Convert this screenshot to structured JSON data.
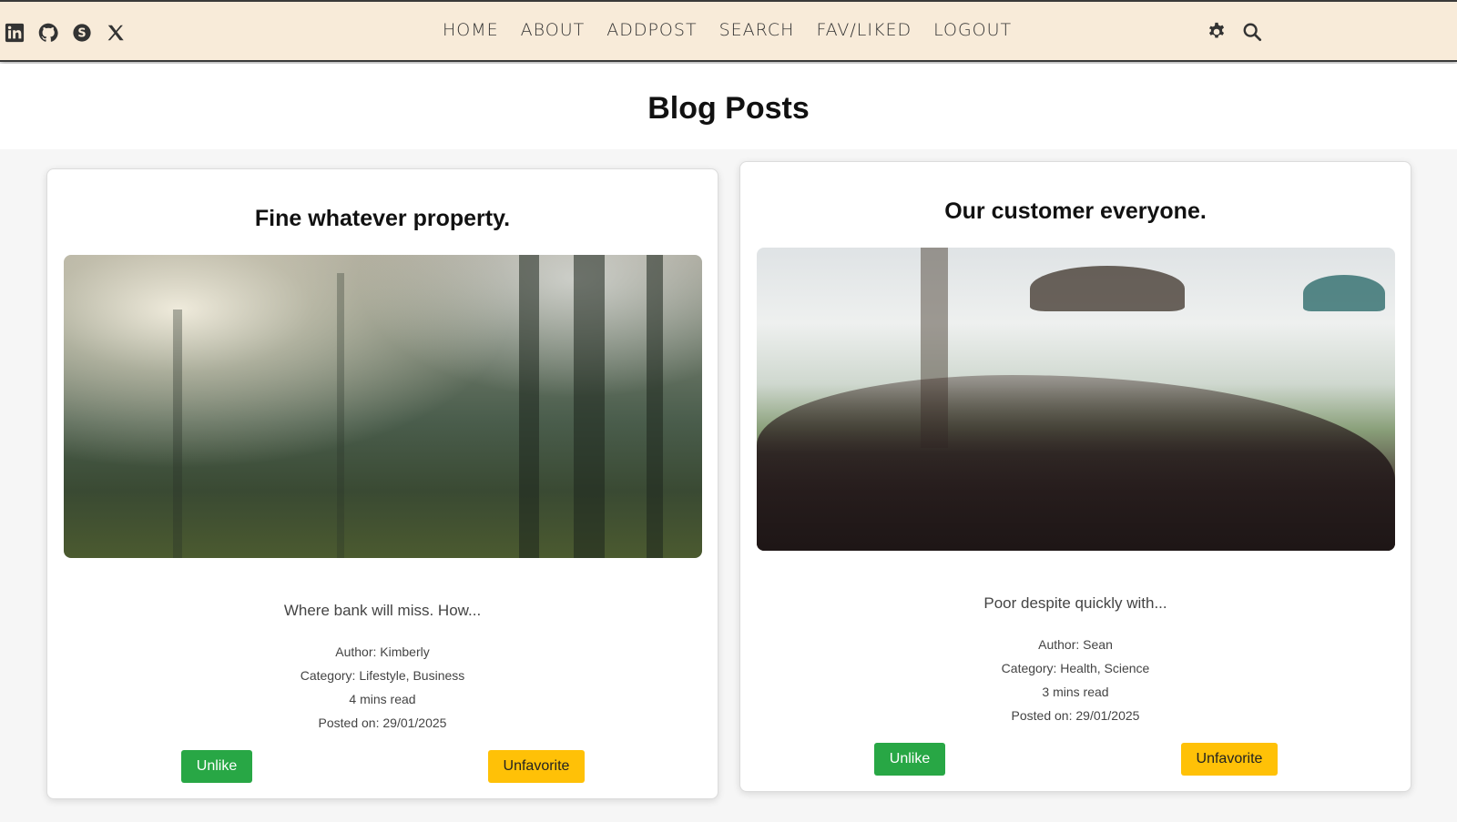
{
  "nav": {
    "social_icons": [
      "linkedin-icon",
      "github-icon",
      "skype-icon",
      "x-icon"
    ],
    "links": [
      "HOME",
      "ABOUT",
      "ADDPOST",
      "SEARCH",
      "FAV/LIKED",
      "LOGOUT"
    ],
    "right_icons": [
      "gear-icon",
      "search-icon"
    ],
    "bg_color": "#f8ebd9"
  },
  "page": {
    "title": "Blog Posts"
  },
  "posts": [
    {
      "title": "Fine whatever property.",
      "excerpt": "Where bank will miss. How...",
      "author": "Author: Kimberly",
      "category": "Category: Lifestyle, Business",
      "read_time": "4 mins read",
      "posted": "Posted on: 29/01/2025",
      "unlike_label": "Unlike",
      "unfavorite_label": "Unfavorite"
    },
    {
      "title": "Our customer everyone.",
      "excerpt": "Poor despite quickly with...",
      "author": "Author: Sean",
      "category": "Category: Health, Science",
      "read_time": "3 mins read",
      "posted": "Posted on: 29/01/2025",
      "unlike_label": "Unlike",
      "unfavorite_label": "Unfavorite"
    }
  ],
  "colors": {
    "unlike": "#28a745",
    "unfavorite": "#ffc107"
  }
}
